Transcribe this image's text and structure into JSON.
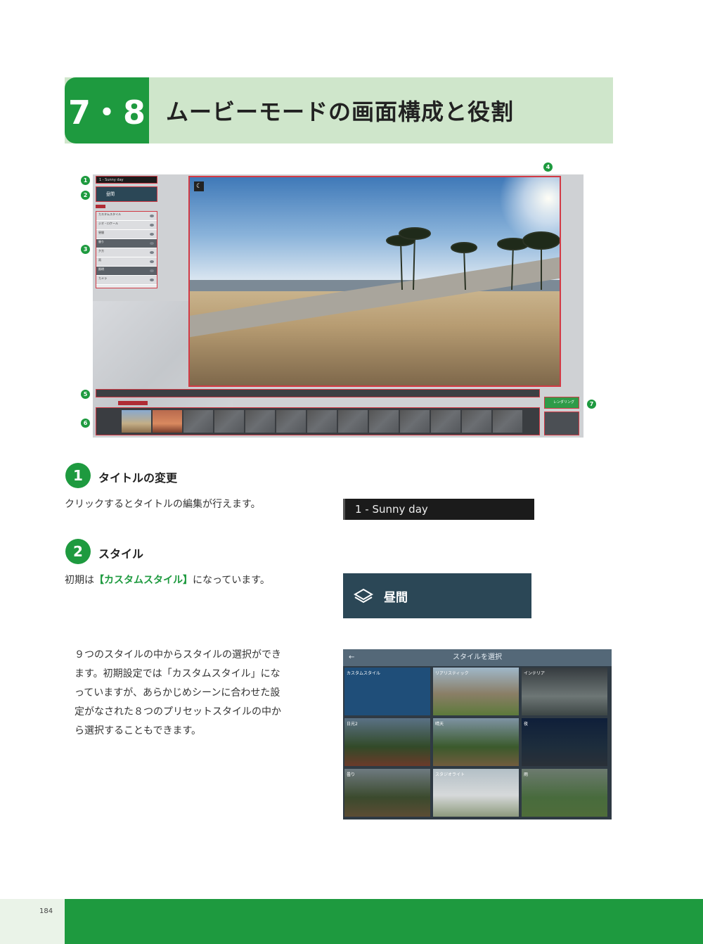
{
  "header": {
    "number": "7・8",
    "title": "ムービーモードの画面構成と役割"
  },
  "screenshot": {
    "title_text": "1 - Sunny day",
    "style_label": "昼間",
    "render_label": "レンダリング",
    "badges": [
      "1",
      "2",
      "3",
      "4",
      "5",
      "6",
      "7"
    ],
    "list_items": [
      "カスタムスタイル",
      "ジオ・ロケール",
      "昼間",
      "曇り",
      "夕方",
      "雨",
      "照明",
      "カメラ"
    ]
  },
  "section1": {
    "number": "1",
    "heading": "タイトルの変更",
    "text": "クリックするとタイトルの編集が行えます。",
    "sample": "1 - Sunny day"
  },
  "section2": {
    "number": "2",
    "heading": "スタイル",
    "text_before": "初期は",
    "highlight": "【カスタムスタイル】",
    "text_after": "になっています。",
    "sample": "昼間",
    "paragraph_lines": [
      "９つのスタイルの中からスタイルの選択ができ",
      "ます。初期設定では「カスタムスタイル」にな",
      "っていますが、あらかじめシーンに合わせた設",
      "定がなされた８つのプリセットスタイルの中か",
      "ら選択することもできます。"
    ]
  },
  "style_select": {
    "title": "スタイルを選択",
    "cells": [
      "カスタムスタイル",
      "リアリスティック",
      "インテリア",
      "日光2",
      "晴天",
      "夜",
      "曇り",
      "スタジオライト",
      "雨"
    ]
  },
  "footer": {
    "page": "184"
  }
}
